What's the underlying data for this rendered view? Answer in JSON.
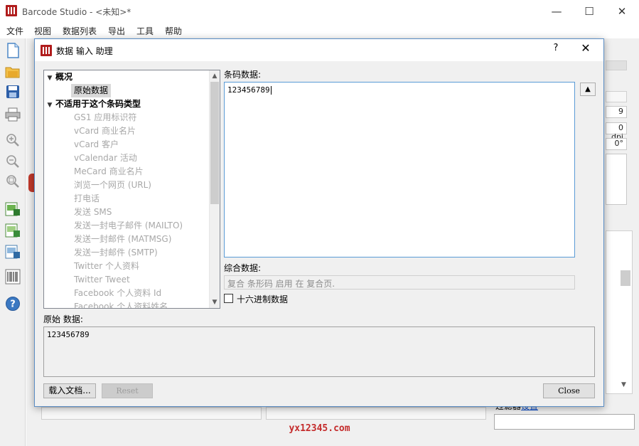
{
  "app": {
    "title": "Barcode Studio - <未知>*"
  },
  "window_controls": {
    "minimize": "—",
    "maximize": "☐",
    "close": "✕"
  },
  "menu": [
    "文件",
    "视图",
    "数据列表",
    "导出",
    "工具",
    "帮助"
  ],
  "toolbar": [
    "new-document-icon",
    "open-folder-icon",
    "save-icon",
    "print-icon",
    "zoom-in-icon",
    "zoom-out-icon",
    "zoom-fit-icon",
    "export-image-icon",
    "export-image-icon",
    "export-image-icon",
    "barcode-list-icon",
    "help-icon"
  ],
  "dialog": {
    "title": "数据 输入 助理",
    "help": "?",
    "close": "✕",
    "tree": {
      "groups": [
        {
          "label": "概况",
          "arrow": "▼",
          "children": [
            {
              "label": "原始数据",
              "selected": true
            }
          ]
        },
        {
          "label": "不适用于这个条码类型",
          "arrow": "▼",
          "children": [
            {
              "label": "GS1 应用标识符"
            },
            {
              "label": "vCard 商业名片"
            },
            {
              "label": "vCard 客户"
            },
            {
              "label": "vCalendar 活动"
            },
            {
              "label": "MeCard 商业名片"
            },
            {
              "label": "浏览一个网页 (URL)"
            },
            {
              "label": "打电话"
            },
            {
              "label": "发送 SMS"
            },
            {
              "label": "发送一封电子邮件 (MAILTO)"
            },
            {
              "label": "发送一封邮件 (MATMSG)"
            },
            {
              "label": "发送一封邮件 (SMTP)"
            },
            {
              "label": "Twitter 个人资料"
            },
            {
              "label": "Twitter Tweet"
            },
            {
              "label": "Facebook 个人资料 Id"
            },
            {
              "label": "Facebook 个人资料姓名"
            }
          ]
        }
      ],
      "scroll_up": "▲",
      "scroll_down": "▼"
    },
    "barcode_data_label": "条码数据:",
    "barcode_data_value": "123456789",
    "up_button": "▲",
    "composite_label": "综合数据:",
    "composite_placeholder": "复合 条形码 启用 在 复合页.",
    "hex_label": "十六进制数据",
    "raw_label": "原始 数据:",
    "raw_value": "123456789",
    "load_button": "载入文档...",
    "reset_button": "Reset",
    "close_button": "Close"
  },
  "background": {
    "field_9": "9",
    "field_dpi": "0 dpi",
    "field_deg": "0°",
    "link_text": "过滤器",
    "link_value": "设置"
  },
  "watermark": "yx12345.com",
  "colors": {
    "accent": "#5a9bd5",
    "brand_red": "#b01c1c",
    "watermark": "#c42b2b"
  }
}
